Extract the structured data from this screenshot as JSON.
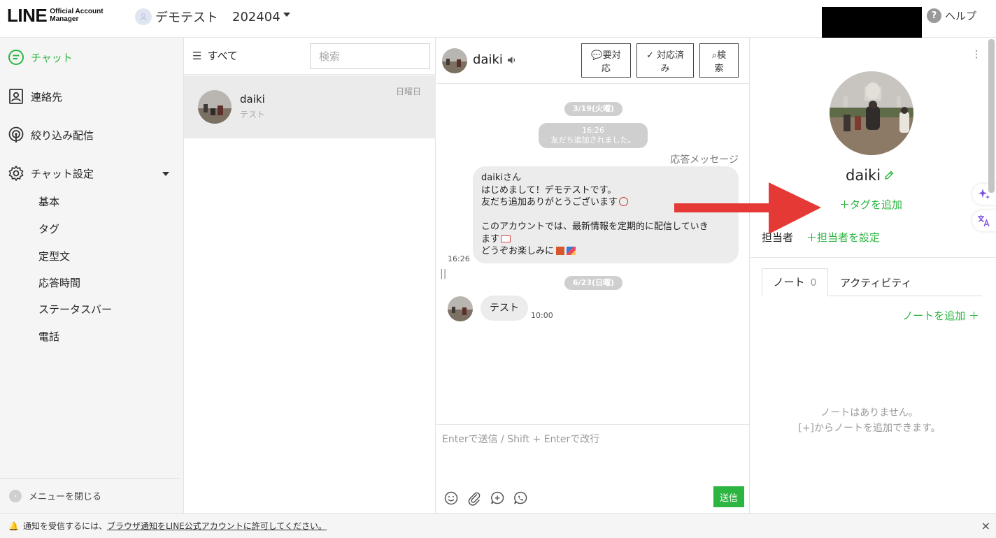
{
  "header": {
    "logo_main": "LINE",
    "logo_sub_line1": "Official Account",
    "logo_sub_line2": "Manager",
    "account_name": "デモテスト",
    "account_month": "202404",
    "help_label": "ヘルプ",
    "help_icon": "?"
  },
  "sidebar": {
    "items": [
      {
        "label": "チャット",
        "icon": "chat-icon",
        "active": true
      },
      {
        "label": "連絡先",
        "icon": "contact-icon",
        "active": false
      },
      {
        "label": "絞り込み配信",
        "icon": "broadcast-icon",
        "active": false
      },
      {
        "label": "チャット設定",
        "icon": "gear-icon",
        "active": false
      }
    ],
    "sub_items": [
      "基本",
      "タグ",
      "定型文",
      "応答時間",
      "ステータスバー",
      "電話"
    ],
    "close_menu": "メニューを閉じる"
  },
  "chat_list": {
    "filter_label": "すべて",
    "search_placeholder": "検索",
    "rows": [
      {
        "name": "daiki",
        "last_message": "テスト",
        "date": "日曜日"
      }
    ]
  },
  "conversation": {
    "name": "daiki",
    "buttons": [
      {
        "label": "要対",
        "label2": "応"
      },
      {
        "label": "対応済",
        "label2": "み"
      },
      {
        "label": "検",
        "label2": "索"
      }
    ],
    "date1": "3/19(火曜)",
    "system_time": "16:26",
    "system_text": "友だち追加されました。",
    "reply_label": "応答メッセージ",
    "greeting_lines": [
      "daikiさん",
      "はじめまして！デモテストです。",
      "友だち追加ありがとうございます",
      "",
      "このアカウントでは、最新情報を定期的に配信していき",
      "ます",
      "どうぞお楽しみに"
    ],
    "greeting_time": "16:26",
    "date2": "6/23(日曜)",
    "user_message": "テスト",
    "user_time": "10:00",
    "composer_placeholder": "Enterで送信 / Shift + Enterで改行",
    "send_label": "送信"
  },
  "profile": {
    "name": "daiki",
    "add_tag": "＋タグを追加",
    "assignee_label": "担当者",
    "assignee_set": "＋担当者を設定",
    "tab_note": "ノート",
    "tab_note_count": "0",
    "tab_activity": "アクティビティ",
    "add_note": "ノートを追加 ＋",
    "empty_line1": "ノートはありません。",
    "empty_line2": "[+]からノートを追加できます。"
  },
  "notification": {
    "text_before": "通知を受信するには、",
    "link": "ブラウザ通知をLINE公式アカウントに許可してください。",
    "close": "×"
  },
  "colors": {
    "brand_green": "#2cb540",
    "arrow_red": "#e53935"
  }
}
